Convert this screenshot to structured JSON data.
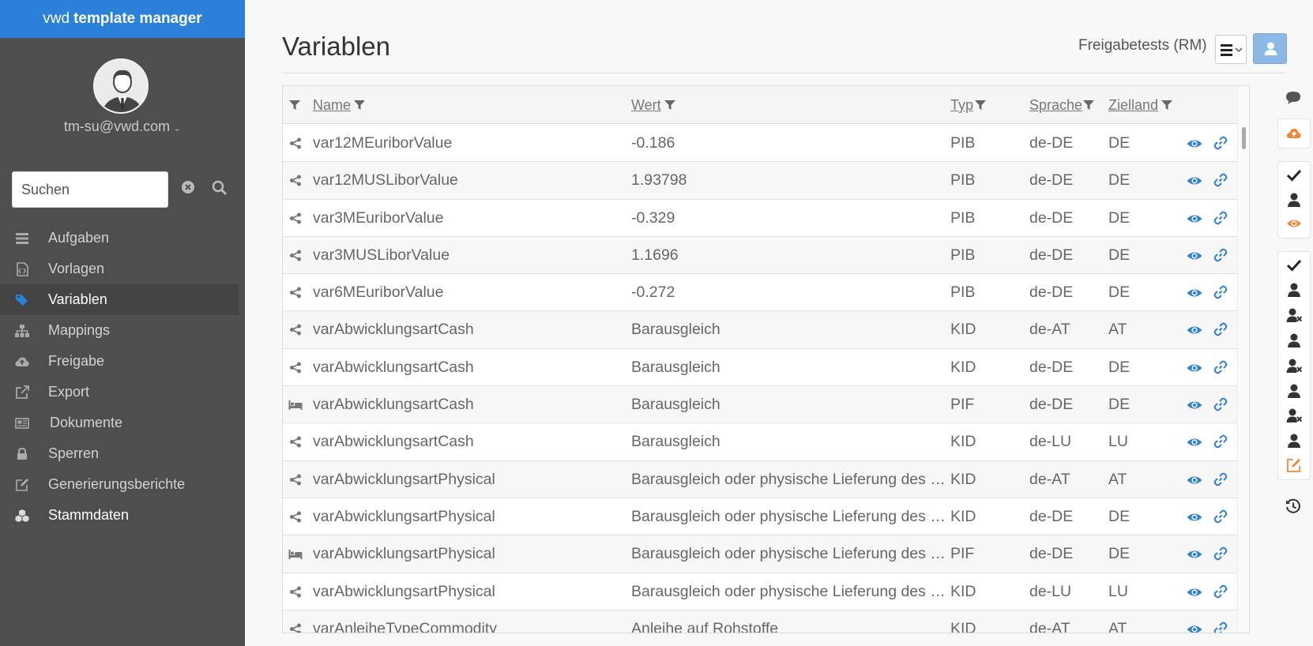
{
  "app": {
    "brand_light": "vwd",
    "brand_bold": "template manager"
  },
  "user": {
    "email": "tm-su@vwd.com"
  },
  "search": {
    "placeholder": "Suchen"
  },
  "nav": [
    {
      "label": "Aufgaben",
      "icon": "tasks-icon"
    },
    {
      "label": "Vorlagen",
      "icon": "template-icon"
    },
    {
      "label": "Variablen",
      "icon": "tags-icon",
      "active": true
    },
    {
      "label": "Mappings",
      "icon": "sitemap-icon"
    },
    {
      "label": "Freigabe",
      "icon": "cloud-upload-icon"
    },
    {
      "label": "Export",
      "icon": "external-link-icon"
    },
    {
      "label": "Dokumente",
      "icon": "newspaper-icon"
    },
    {
      "label": "Sperren",
      "icon": "lock-icon"
    },
    {
      "label": "Generierungsberichte",
      "icon": "edit-icon"
    },
    {
      "label": "Stammdaten",
      "icon": "cubes-icon"
    }
  ],
  "header": {
    "title": "Variablen",
    "environment": "Freigabetests (RM)"
  },
  "table": {
    "columns": {
      "name": "Name",
      "wert": "Wert",
      "typ": "Typ",
      "sprache": "Sprache",
      "zielland": "Zielland"
    },
    "rows": [
      {
        "icon": "share-icon",
        "name": "var12MEuriborValue",
        "wert": "-0.186",
        "typ": "PIB",
        "sprache": "de-DE",
        "zielland": "DE"
      },
      {
        "icon": "share-icon",
        "name": "var12MUSLiborValue",
        "wert": "1.93798",
        "typ": "PIB",
        "sprache": "de-DE",
        "zielland": "DE"
      },
      {
        "icon": "share-icon",
        "name": "var3MEuriborValue",
        "wert": "-0.329",
        "typ": "PIB",
        "sprache": "de-DE",
        "zielland": "DE"
      },
      {
        "icon": "share-icon",
        "name": "var3MUSLiborValue",
        "wert": "1.1696",
        "typ": "PIB",
        "sprache": "de-DE",
        "zielland": "DE"
      },
      {
        "icon": "share-icon",
        "name": "var6MEuriborValue",
        "wert": "-0.272",
        "typ": "PIB",
        "sprache": "de-DE",
        "zielland": "DE"
      },
      {
        "icon": "share-icon",
        "name": "varAbwicklungsartCash",
        "wert": "Barausgleich",
        "typ": "KID",
        "sprache": "de-AT",
        "zielland": "AT"
      },
      {
        "icon": "share-icon",
        "name": "varAbwicklungsartCash",
        "wert": "Barausgleich",
        "typ": "KID",
        "sprache": "de-DE",
        "zielland": "DE"
      },
      {
        "icon": "bed-icon",
        "name": "varAbwicklungsartCash",
        "wert": "Barausgleich",
        "typ": "PIF",
        "sprache": "de-DE",
        "zielland": "DE"
      },
      {
        "icon": "share-icon",
        "name": "varAbwicklungsartCash",
        "wert": "Barausgleich",
        "typ": "KID",
        "sprache": "de-LU",
        "zielland": "LU"
      },
      {
        "icon": "share-icon",
        "name": "varAbwicklungsartPhysical",
        "wert": "Barausgleich oder physische Lieferung des Basiswerts",
        "typ": "KID",
        "sprache": "de-AT",
        "zielland": "AT"
      },
      {
        "icon": "share-icon",
        "name": "varAbwicklungsartPhysical",
        "wert": "Barausgleich oder physische Lieferung des Basiswerts",
        "typ": "KID",
        "sprache": "de-DE",
        "zielland": "DE"
      },
      {
        "icon": "bed-icon",
        "name": "varAbwicklungsartPhysical",
        "wert": "Barausgleich oder physische Lieferung des Basiswerts",
        "typ": "PIF",
        "sprache": "de-DE",
        "zielland": "DE"
      },
      {
        "icon": "share-icon",
        "name": "varAbwicklungsartPhysical",
        "wert": "Barausgleich oder physische Lieferung des Basiswerts",
        "typ": "KID",
        "sprache": "de-LU",
        "zielland": "LU"
      },
      {
        "icon": "share-icon",
        "name": "varAnleiheTypeCommodity",
        "wert": "Anleihe auf Rohstoffe",
        "typ": "KID",
        "sprache": "de-AT",
        "zielland": "AT"
      }
    ]
  },
  "colors": {
    "brand": "#2b80d9",
    "sidebar": "#4e4e4e",
    "accent_blue": "#2b80d9",
    "accent_orange": "#f0883a"
  }
}
